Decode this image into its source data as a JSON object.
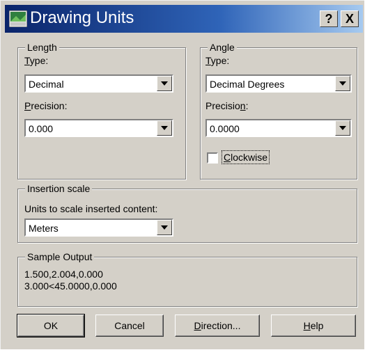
{
  "window": {
    "title": "Drawing Units",
    "help_btn": "?",
    "close_btn": "X"
  },
  "length": {
    "legend": "Length",
    "type_label": "Type:",
    "type_value": "Decimal",
    "precision_label": "Precision:",
    "precision_value": "0.000"
  },
  "angle": {
    "legend": "Angle",
    "type_label": "Type:",
    "type_value": "Decimal Degrees",
    "precision_label": "Precision:",
    "precision_value": "0.0000",
    "clockwise_label": "Clockwise",
    "clockwise_checked": false
  },
  "insertion": {
    "legend": "Insertion scale",
    "units_label": "Units to scale inserted content:",
    "units_value": "Meters"
  },
  "sample": {
    "legend": "Sample Output",
    "line1": "1.500,2.004,0.000",
    "line2": "3.000<45.0000,0.000"
  },
  "buttons": {
    "ok": "OK",
    "cancel": "Cancel",
    "direction": "Direction...",
    "help": "Help"
  }
}
